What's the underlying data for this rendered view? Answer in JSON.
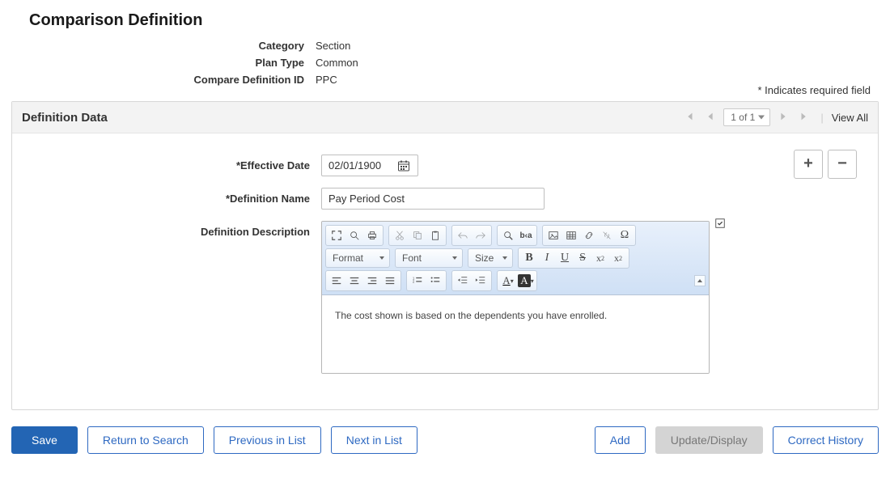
{
  "page": {
    "title": "Comparison Definition",
    "required_note": "* Indicates required field"
  },
  "header": {
    "category_label": "Category",
    "category_value": "Section",
    "plan_type_label": "Plan Type",
    "plan_type_value": "Common",
    "def_id_label": "Compare Definition ID",
    "def_id_value": "PPC"
  },
  "panel": {
    "title": "Definition Data",
    "pager": {
      "label": "1 of 1"
    },
    "view_all": "View All"
  },
  "form": {
    "effective_date_label": "*Effective Date",
    "effective_date_value": "02/01/1900",
    "definition_name_label": "*Definition Name",
    "definition_name_value": "Pay Period Cost",
    "definition_desc_label": "Definition Description",
    "rte": {
      "format_label": "Format",
      "font_label": "Font",
      "size_label": "Size",
      "body": "The cost shown is based on the dependents you have enrolled."
    }
  },
  "row_buttons": {
    "add": "+",
    "delete": "−"
  },
  "actions": {
    "save": "Save",
    "return": "Return to Search",
    "prev": "Previous in List",
    "next": "Next in List",
    "add": "Add",
    "update": "Update/Display",
    "correct": "Correct History"
  }
}
